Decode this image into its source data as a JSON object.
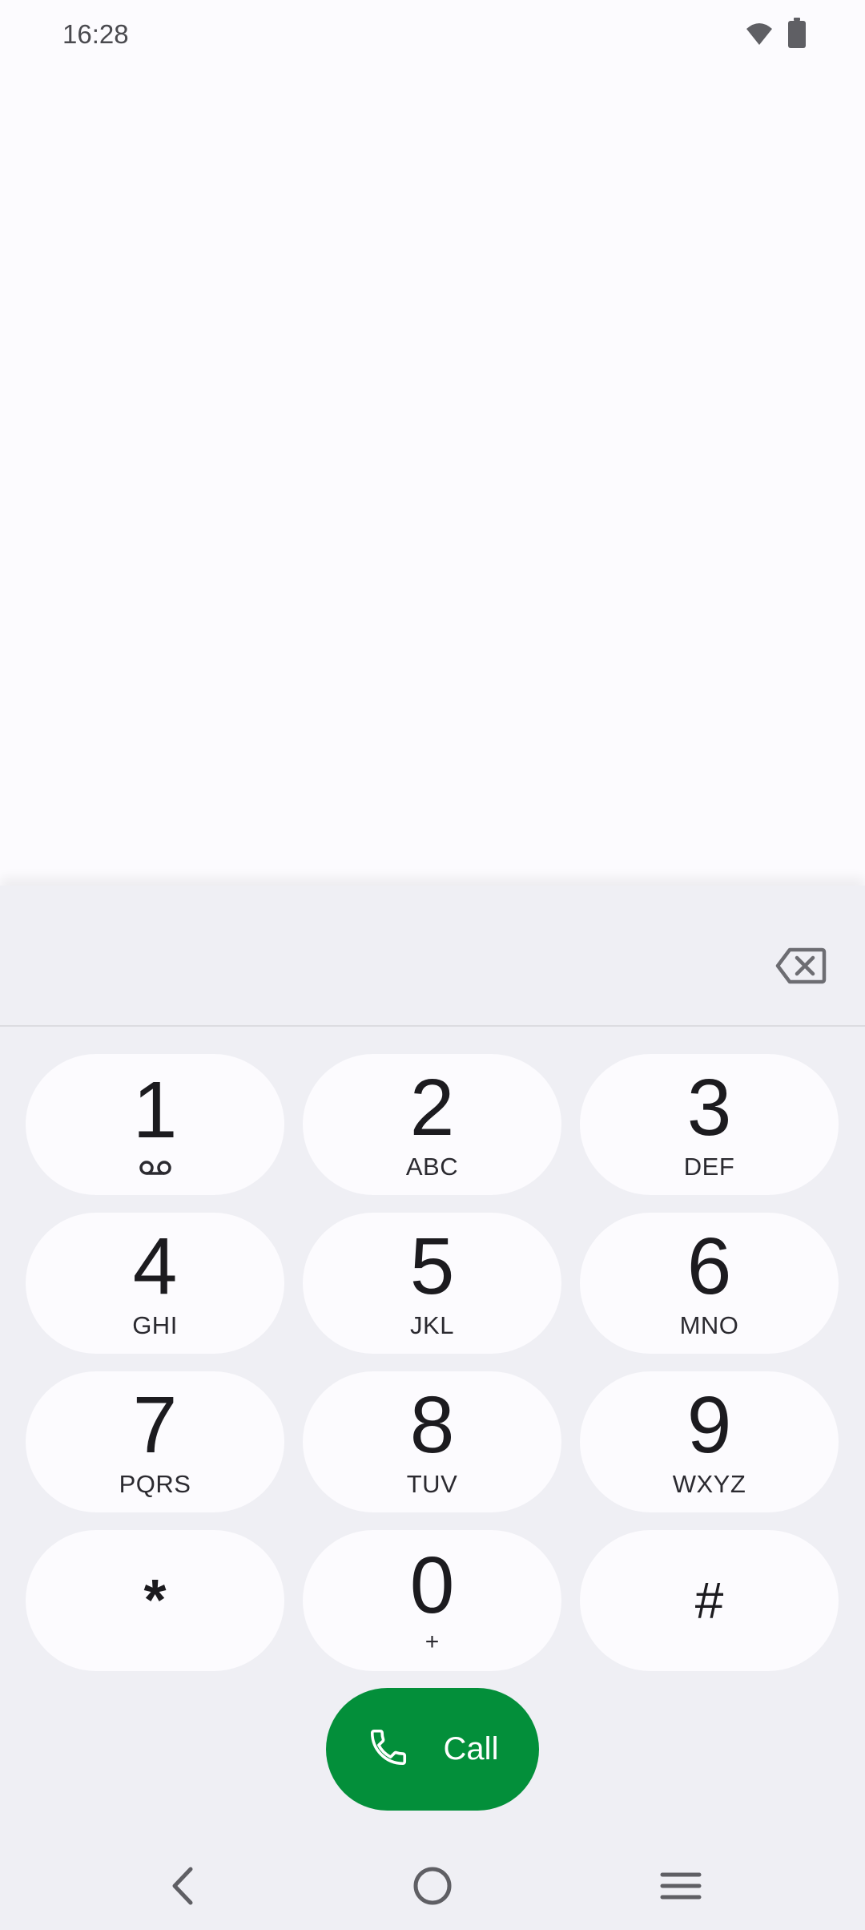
{
  "status_bar": {
    "time": "16:28",
    "icons": [
      "wifi-icon",
      "battery-icon"
    ]
  },
  "dialer": {
    "digits": "",
    "keys": [
      {
        "digit": "1",
        "letters": "",
        "extra_icon": "voicemail-icon"
      },
      {
        "digit": "2",
        "letters": "ABC"
      },
      {
        "digit": "3",
        "letters": "DEF"
      },
      {
        "digit": "4",
        "letters": "GHI"
      },
      {
        "digit": "5",
        "letters": "JKL"
      },
      {
        "digit": "6",
        "letters": "MNO"
      },
      {
        "digit": "7",
        "letters": "PQRS"
      },
      {
        "digit": "8",
        "letters": "TUV"
      },
      {
        "digit": "9",
        "letters": "WXYZ"
      },
      {
        "digit": "*",
        "letters": ""
      },
      {
        "digit": "0",
        "letters": "+"
      },
      {
        "digit": "#",
        "letters": ""
      }
    ],
    "call_label": "Call"
  },
  "colors": {
    "call_button": "#038f3a",
    "key_background": "#fcfbfe",
    "sheet_background": "#efeff4"
  },
  "nav_bar": {
    "buttons": [
      "back-icon",
      "home-icon",
      "recents-icon"
    ]
  }
}
